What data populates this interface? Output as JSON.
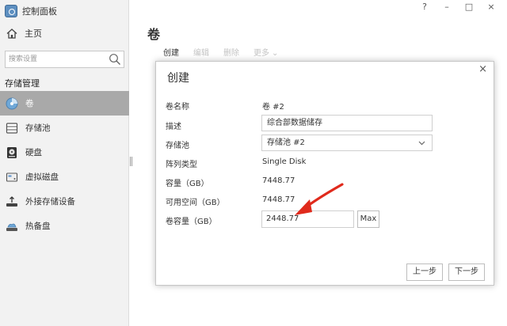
{
  "app": {
    "title": "控制面板"
  },
  "window_controls": {
    "help": "?",
    "minimize": "–",
    "maximize": "□",
    "close": "×"
  },
  "sidebar": {
    "home_label": "主页",
    "search_placeholder": "搜索设置",
    "section_title": "存储管理",
    "items": [
      {
        "label": "卷",
        "icon": "volume-disk-icon",
        "active": true
      },
      {
        "label": "存储池",
        "icon": "storage-pool-icon",
        "active": false
      },
      {
        "label": "硬盘",
        "icon": "hdd-icon",
        "active": false
      },
      {
        "label": "虚拟磁盘",
        "icon": "virtual-disk-icon",
        "active": false
      },
      {
        "label": "外接存储设备",
        "icon": "external-device-icon",
        "active": false
      },
      {
        "label": "热备盘",
        "icon": "hot-spare-icon",
        "active": false
      }
    ]
  },
  "main": {
    "title": "卷",
    "toolbar": {
      "create": "创建",
      "edit": "编辑",
      "delete": "删除",
      "more": "更多"
    }
  },
  "dialog": {
    "title": "创建",
    "fields": {
      "name": {
        "label": "卷名称",
        "value": "卷 #2"
      },
      "description": {
        "label": "描述",
        "value": "综合部数据储存"
      },
      "pool": {
        "label": "存储池",
        "value": "存储池 #2"
      },
      "raid_type": {
        "label": "阵列类型",
        "value": "Single Disk"
      },
      "capacity": {
        "label": "容量（GB）",
        "value": "7448.77"
      },
      "available": {
        "label": "可用空间（GB）",
        "value": "7448.77"
      },
      "volume_capacity": {
        "label": "卷容量（GB）",
        "value": "2448.77"
      }
    },
    "max_label": "Max",
    "prev_label": "上一步",
    "next_label": "下一步"
  },
  "colors": {
    "active_nav_bg": "#a9a9a9",
    "arrow": "#e02a1c",
    "sidebar_bg": "#f2f2f2"
  }
}
